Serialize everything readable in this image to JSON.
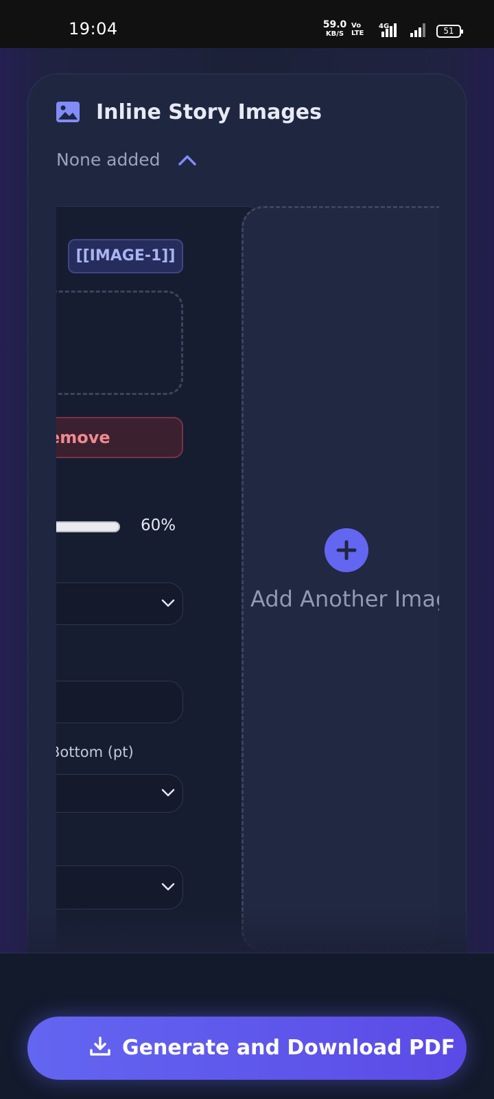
{
  "status_bar": {
    "time": "19:04",
    "net_speed": "59.0",
    "net_unit": "KB/S",
    "volte": "VoLTE2",
    "network": "4G",
    "battery": "51"
  },
  "section": {
    "title": "Inline Story Images",
    "status": "None added",
    "icon": "image-icon"
  },
  "image_card": {
    "tag": "[[IMAGE-1]]",
    "remove_label": "emove",
    "scale_value": "60%",
    "margin_label": "Bottom (pt)"
  },
  "add_card": {
    "label": "Add Another Image",
    "icon": "plus-icon"
  },
  "footer": {
    "generate_label": "Generate and Download PDF",
    "icon": "download-icon"
  },
  "colors": {
    "accent": "#6366f1",
    "danger": "#f1898f",
    "background": "#1c2139"
  }
}
